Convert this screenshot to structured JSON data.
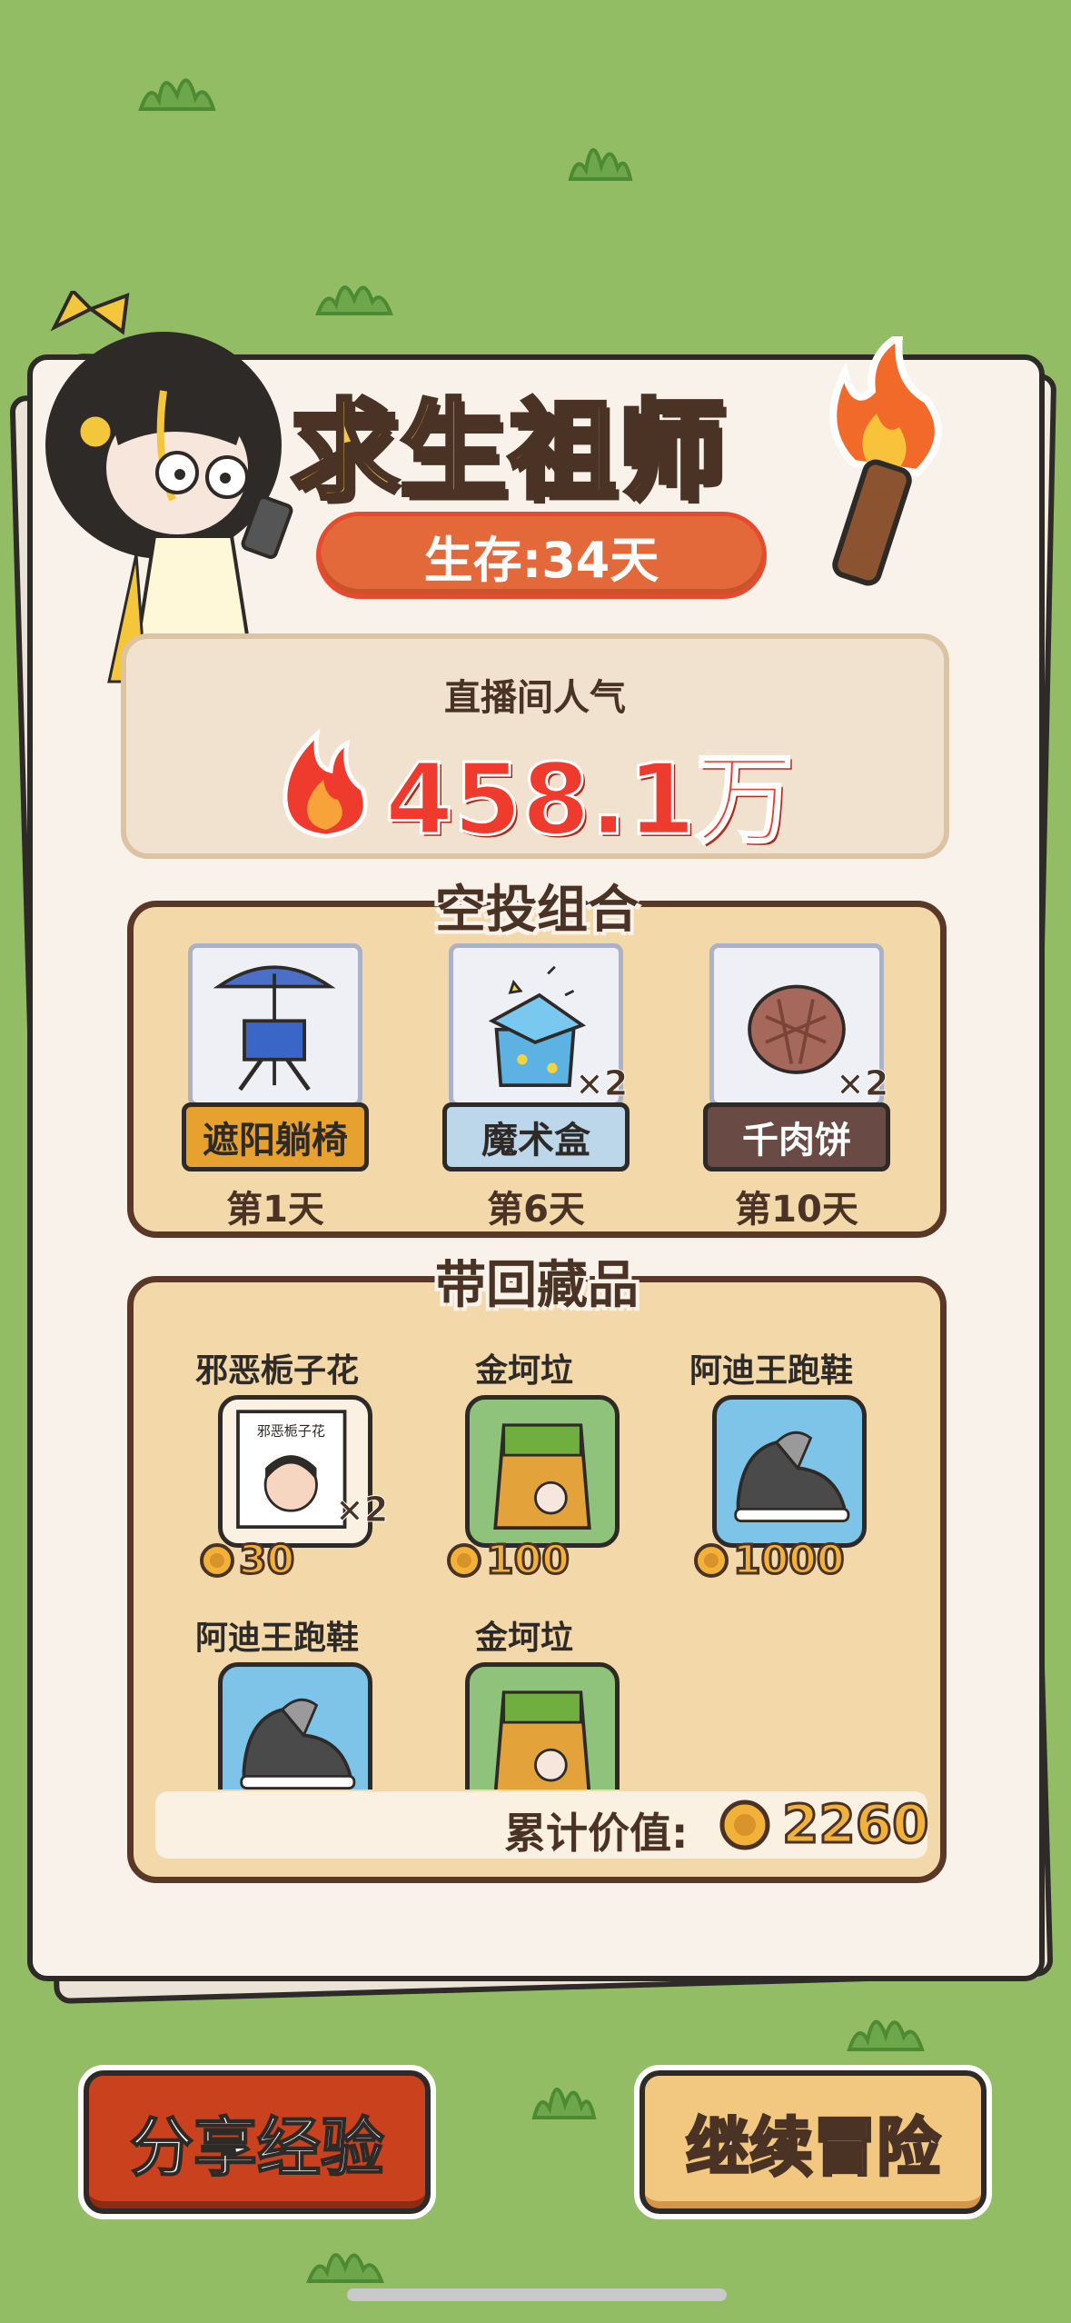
{
  "title": "求生祖师",
  "survival": "生存:34天",
  "popularity": {
    "label": "直播间人气",
    "value": "458.1万"
  },
  "airdrop": {
    "title": "空投组合",
    "items": [
      {
        "name": "遮阳躺椅",
        "day": "第1天",
        "qty": "",
        "label_color": "#e6a12f",
        "text_color": "#2e2a28"
      },
      {
        "name": "魔术盒",
        "day": "第6天",
        "qty": "×2",
        "label_color": "#bcd7ea",
        "text_color": "#2e2a28"
      },
      {
        "name": "千肉饼",
        "day": "第10天",
        "qty": "×2",
        "label_color": "#6a4a44",
        "text_color": "#ffffff"
      }
    ]
  },
  "collection": {
    "title": "带回藏品",
    "items": [
      {
        "name": "邪恶栀子花",
        "price": "30",
        "qty": "×2",
        "icon": "book-icon",
        "bg": "#fbf1e3"
      },
      {
        "name": "金坷垃",
        "price": "100",
        "qty": "",
        "icon": "fertilizer-bag-icon",
        "bg": "#8fc27a"
      },
      {
        "name": "阿迪王跑鞋",
        "price": "1000",
        "qty": "",
        "icon": "sneaker-icon",
        "bg": "#7ec3e8"
      },
      {
        "name": "阿迪王跑鞋",
        "price": "",
        "qty": "",
        "icon": "sneaker-icon",
        "bg": "#7ec3e8"
      },
      {
        "name": "金坷垃",
        "price": "",
        "qty": "",
        "icon": "fertilizer-bag-icon",
        "bg": "#8fc27a"
      }
    ],
    "total_label": "累计价值:",
    "total_value": "2260"
  },
  "buttons": {
    "share": "分享经验",
    "continue": "继续冒险"
  },
  "colors": {
    "background": "#93bd64",
    "paper": "#f8f2eb",
    "panel": "#f3d9a9",
    "accent_red": "#ef3b2d",
    "coin": "#f2b23a"
  }
}
